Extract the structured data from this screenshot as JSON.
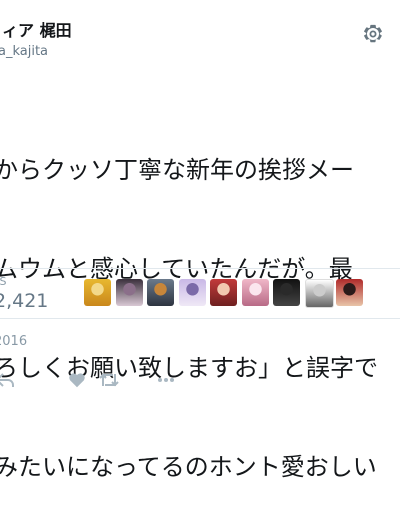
{
  "header": {
    "display_name": "ィア 梶田",
    "username": "a_kajita"
  },
  "tweet": {
    "lines": [
      "からクッソ丁寧な新年の挨拶メー",
      "ムウムと感心していたんだが。最",
      "ろしくお願い致しますお」と誤字で",
      "みたいになってるのホント愛おしい"
    ]
  },
  "stats": {
    "likes_label": "ES",
    "likes_value": "2,421"
  },
  "liker_avatars": [
    {
      "name": "yellow-character-avatar",
      "colors": [
        "#e8b830",
        "#f3d98a",
        "#c9871c"
      ]
    },
    {
      "name": "dark-hair-character-avatar",
      "colors": [
        "#3a2f3c",
        "#8b6f8a",
        "#d9c8d4"
      ]
    },
    {
      "name": "train-avatar",
      "colors": [
        "#6b7a8c",
        "#c7863a",
        "#2d3440"
      ]
    },
    {
      "name": "purple-character-avatar",
      "colors": [
        "#c9b8e6",
        "#7b6aa8",
        "#efe8f6"
      ]
    },
    {
      "name": "red-hair-character-avatar",
      "colors": [
        "#c23b3b",
        "#f2c9b0",
        "#6e2020"
      ]
    },
    {
      "name": "pink-character-avatar",
      "colors": [
        "#f0b7c8",
        "#fbe6ee",
        "#b86a86"
      ]
    },
    {
      "name": "black-avatar",
      "colors": [
        "#111111",
        "#2a2a2a",
        "#444444"
      ]
    },
    {
      "name": "sketch-character-avatar",
      "colors": [
        "#ffffff",
        "#cccccc",
        "#666666"
      ]
    },
    {
      "name": "red-outfit-character-avatar",
      "colors": [
        "#b02a2a",
        "#2b1a1a",
        "#e8c4a8"
      ]
    }
  ],
  "date": "2016",
  "colors": {
    "text": "#14171a",
    "muted": "#657786",
    "divider": "#e1e8ed",
    "icon": "#aab8c2"
  }
}
